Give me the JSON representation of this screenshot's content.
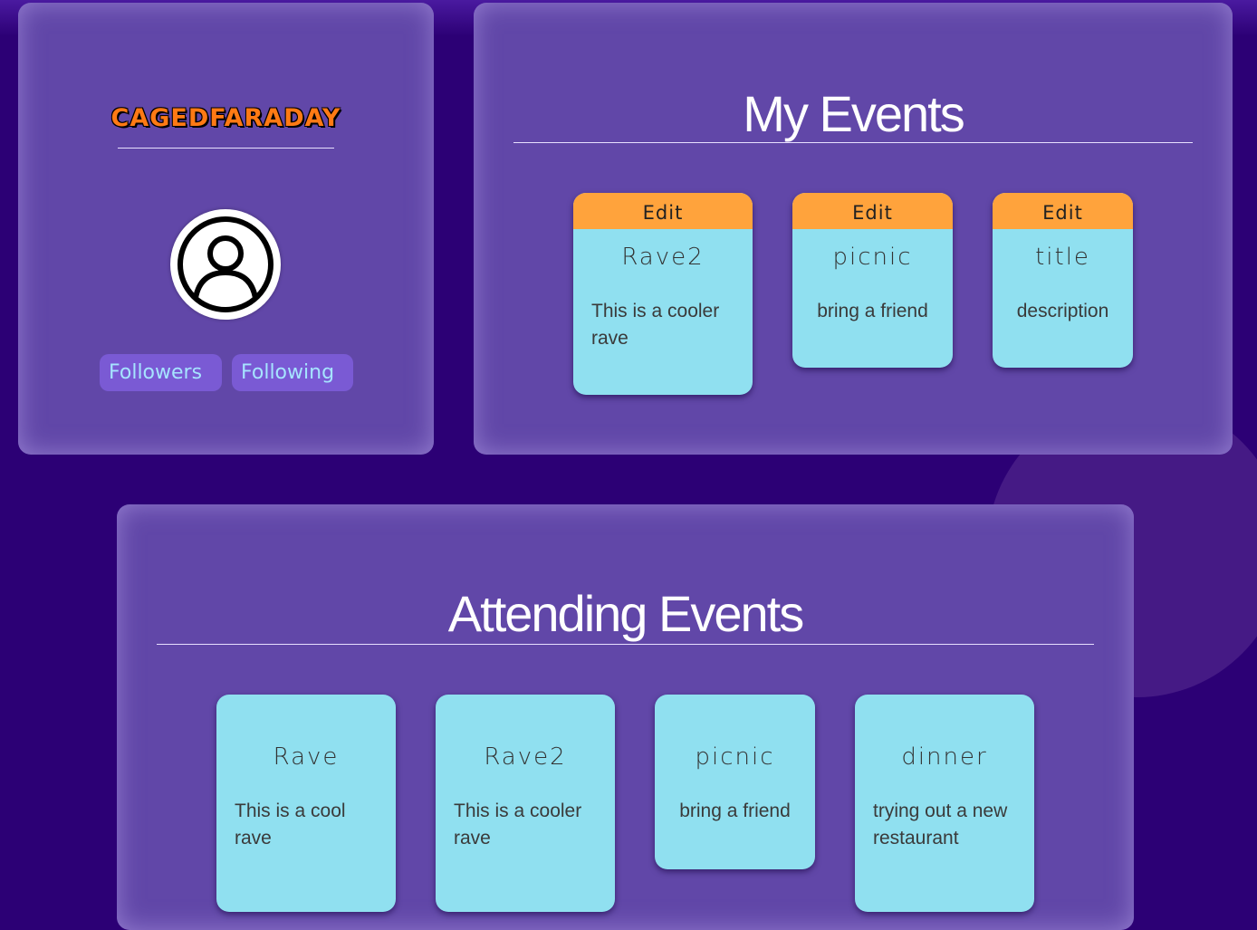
{
  "profile": {
    "username": "CAGEDFARADAY",
    "followers_label": "Followers",
    "following_label": "Following"
  },
  "my_events": {
    "title": "My Events",
    "edit_label": "Edit",
    "cards": [
      {
        "title": "Rave2",
        "description": "This is a cooler rave"
      },
      {
        "title": "picnic",
        "description": "bring a friend"
      },
      {
        "title": "title",
        "description": "description"
      }
    ]
  },
  "attending_events": {
    "title": "Attending Events",
    "cards": [
      {
        "title": "Rave",
        "description": "This is a cool rave"
      },
      {
        "title": "Rave2",
        "description": "This is a cooler rave"
      },
      {
        "title": "picnic",
        "description": "bring a friend"
      },
      {
        "title": "dinner",
        "description": "trying out a new restaurant"
      }
    ]
  },
  "colors": {
    "background": "#2c0075",
    "panel": "#6147a8",
    "card": "#90e0f0",
    "edit_button": "#ffa33c",
    "username": "#ff7a14",
    "follow_text": "#a6e4ff"
  }
}
